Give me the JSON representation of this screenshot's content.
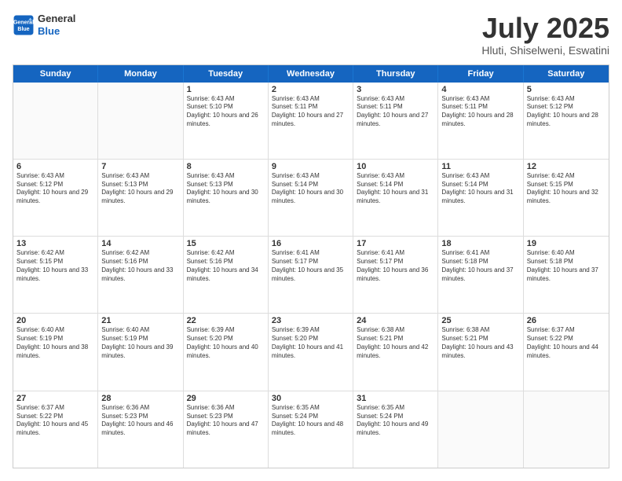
{
  "logo": {
    "line1": "General",
    "line2": "Blue"
  },
  "title": "July 2025",
  "subtitle": "Hluti, Shiselweni, Eswatini",
  "days_of_week": [
    "Sunday",
    "Monday",
    "Tuesday",
    "Wednesday",
    "Thursday",
    "Friday",
    "Saturday"
  ],
  "weeks": [
    [
      {
        "day": "",
        "info": ""
      },
      {
        "day": "",
        "info": ""
      },
      {
        "day": "1",
        "info": "Sunrise: 6:43 AM\nSunset: 5:10 PM\nDaylight: 10 hours and 26 minutes."
      },
      {
        "day": "2",
        "info": "Sunrise: 6:43 AM\nSunset: 5:11 PM\nDaylight: 10 hours and 27 minutes."
      },
      {
        "day": "3",
        "info": "Sunrise: 6:43 AM\nSunset: 5:11 PM\nDaylight: 10 hours and 27 minutes."
      },
      {
        "day": "4",
        "info": "Sunrise: 6:43 AM\nSunset: 5:11 PM\nDaylight: 10 hours and 28 minutes."
      },
      {
        "day": "5",
        "info": "Sunrise: 6:43 AM\nSunset: 5:12 PM\nDaylight: 10 hours and 28 minutes."
      }
    ],
    [
      {
        "day": "6",
        "info": "Sunrise: 6:43 AM\nSunset: 5:12 PM\nDaylight: 10 hours and 29 minutes."
      },
      {
        "day": "7",
        "info": "Sunrise: 6:43 AM\nSunset: 5:13 PM\nDaylight: 10 hours and 29 minutes."
      },
      {
        "day": "8",
        "info": "Sunrise: 6:43 AM\nSunset: 5:13 PM\nDaylight: 10 hours and 30 minutes."
      },
      {
        "day": "9",
        "info": "Sunrise: 6:43 AM\nSunset: 5:14 PM\nDaylight: 10 hours and 30 minutes."
      },
      {
        "day": "10",
        "info": "Sunrise: 6:43 AM\nSunset: 5:14 PM\nDaylight: 10 hours and 31 minutes."
      },
      {
        "day": "11",
        "info": "Sunrise: 6:43 AM\nSunset: 5:14 PM\nDaylight: 10 hours and 31 minutes."
      },
      {
        "day": "12",
        "info": "Sunrise: 6:42 AM\nSunset: 5:15 PM\nDaylight: 10 hours and 32 minutes."
      }
    ],
    [
      {
        "day": "13",
        "info": "Sunrise: 6:42 AM\nSunset: 5:15 PM\nDaylight: 10 hours and 33 minutes."
      },
      {
        "day": "14",
        "info": "Sunrise: 6:42 AM\nSunset: 5:16 PM\nDaylight: 10 hours and 33 minutes."
      },
      {
        "day": "15",
        "info": "Sunrise: 6:42 AM\nSunset: 5:16 PM\nDaylight: 10 hours and 34 minutes."
      },
      {
        "day": "16",
        "info": "Sunrise: 6:41 AM\nSunset: 5:17 PM\nDaylight: 10 hours and 35 minutes."
      },
      {
        "day": "17",
        "info": "Sunrise: 6:41 AM\nSunset: 5:17 PM\nDaylight: 10 hours and 36 minutes."
      },
      {
        "day": "18",
        "info": "Sunrise: 6:41 AM\nSunset: 5:18 PM\nDaylight: 10 hours and 37 minutes."
      },
      {
        "day": "19",
        "info": "Sunrise: 6:40 AM\nSunset: 5:18 PM\nDaylight: 10 hours and 37 minutes."
      }
    ],
    [
      {
        "day": "20",
        "info": "Sunrise: 6:40 AM\nSunset: 5:19 PM\nDaylight: 10 hours and 38 minutes."
      },
      {
        "day": "21",
        "info": "Sunrise: 6:40 AM\nSunset: 5:19 PM\nDaylight: 10 hours and 39 minutes."
      },
      {
        "day": "22",
        "info": "Sunrise: 6:39 AM\nSunset: 5:20 PM\nDaylight: 10 hours and 40 minutes."
      },
      {
        "day": "23",
        "info": "Sunrise: 6:39 AM\nSunset: 5:20 PM\nDaylight: 10 hours and 41 minutes."
      },
      {
        "day": "24",
        "info": "Sunrise: 6:38 AM\nSunset: 5:21 PM\nDaylight: 10 hours and 42 minutes."
      },
      {
        "day": "25",
        "info": "Sunrise: 6:38 AM\nSunset: 5:21 PM\nDaylight: 10 hours and 43 minutes."
      },
      {
        "day": "26",
        "info": "Sunrise: 6:37 AM\nSunset: 5:22 PM\nDaylight: 10 hours and 44 minutes."
      }
    ],
    [
      {
        "day": "27",
        "info": "Sunrise: 6:37 AM\nSunset: 5:22 PM\nDaylight: 10 hours and 45 minutes."
      },
      {
        "day": "28",
        "info": "Sunrise: 6:36 AM\nSunset: 5:23 PM\nDaylight: 10 hours and 46 minutes."
      },
      {
        "day": "29",
        "info": "Sunrise: 6:36 AM\nSunset: 5:23 PM\nDaylight: 10 hours and 47 minutes."
      },
      {
        "day": "30",
        "info": "Sunrise: 6:35 AM\nSunset: 5:24 PM\nDaylight: 10 hours and 48 minutes."
      },
      {
        "day": "31",
        "info": "Sunrise: 6:35 AM\nSunset: 5:24 PM\nDaylight: 10 hours and 49 minutes."
      },
      {
        "day": "",
        "info": ""
      },
      {
        "day": "",
        "info": ""
      }
    ]
  ]
}
